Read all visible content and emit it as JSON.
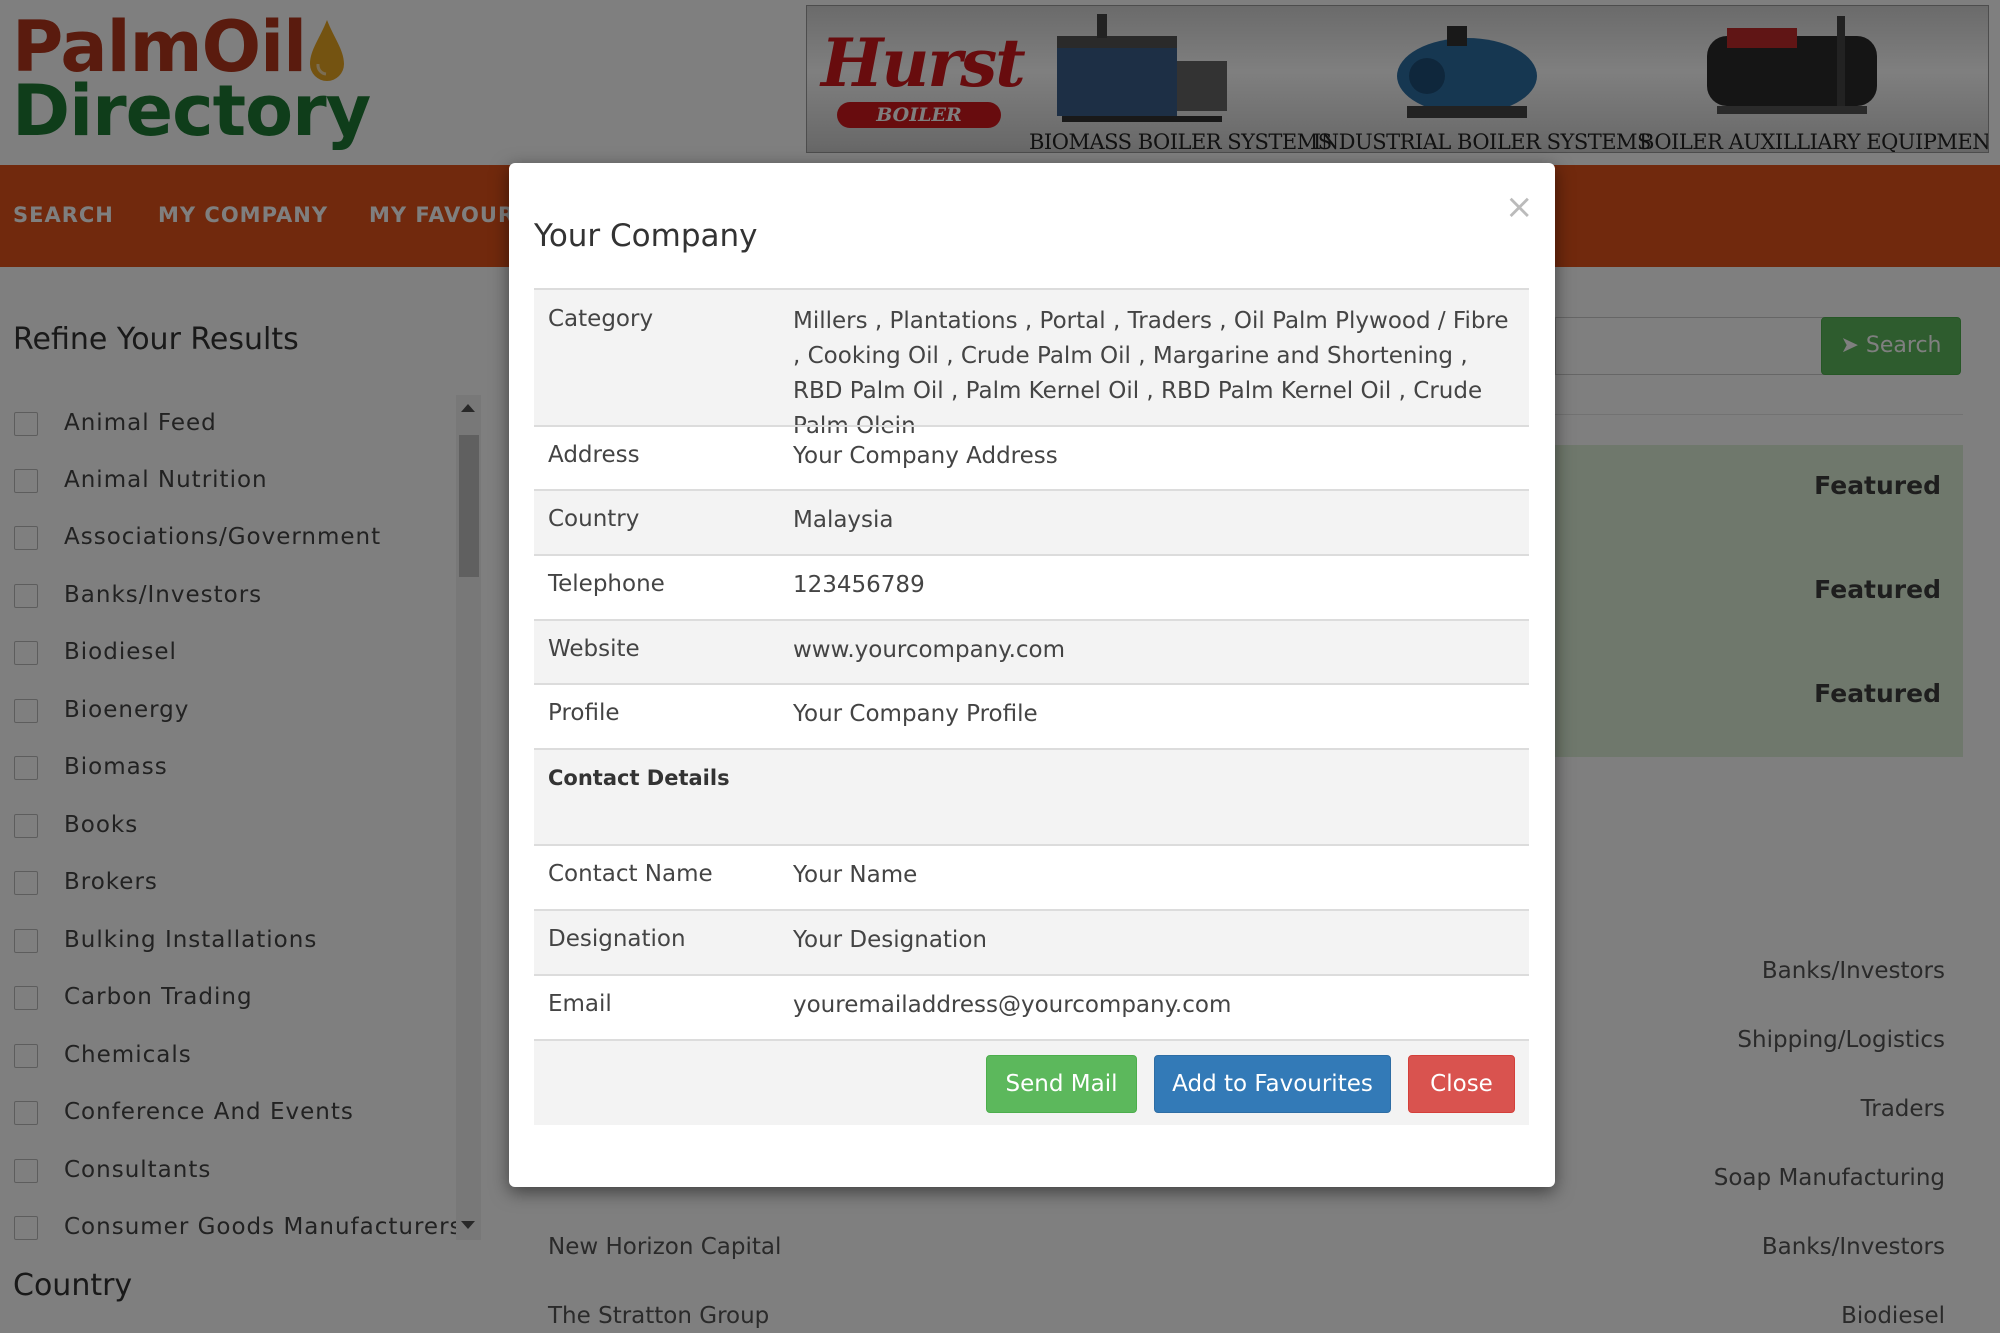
{
  "logo": {
    "line1": "PalmOil",
    "line2": "Directory"
  },
  "banner": {
    "brand": "Hurst",
    "brand_sub": "BOILER",
    "captions": [
      "BIOMASS BOILER SYSTEMS",
      "INDUSTRIAL BOILER SYSTEMS",
      "BOILER AUXILLIARY EQUIPMENT"
    ]
  },
  "nav": {
    "items": [
      "SEARCH",
      "MY COMPANY",
      "MY FAVOUR"
    ]
  },
  "sidebar": {
    "title": "Refine Your Results",
    "categories": [
      "Animal Feed",
      "Animal Nutrition",
      "Associations/Government",
      "Banks/Investors",
      "Biodiesel",
      "Bioenergy",
      "Biomass",
      "Books",
      "Brokers",
      "Bulking Installations",
      "Carbon Trading",
      "Chemicals",
      "Conference And Events",
      "Consultants",
      "Consumer Goods Manufacturers"
    ],
    "country_title": "Country"
  },
  "main": {
    "search_button": "Search",
    "featured_label": "Featured",
    "right_categories": [
      "Banks/Investors",
      "Shipping/Logistics",
      "Traders",
      "Soap Manufacturing",
      "Banks/Investors",
      "Biodiesel"
    ],
    "companies": [
      "New Horizon Capital",
      "The Stratton Group"
    ]
  },
  "modal": {
    "title": "Your Company",
    "close_glyph": "×",
    "rows": [
      {
        "key": "Category",
        "value": "Millers , Plantations , Portal , Traders , Oil Palm Plywood / Fibre , Cooking Oil , Crude Palm Oil , Margarine and Shortening , RBD Palm Oil , Palm Kernel Oil , RBD Palm Kernel Oil , Crude Palm Olein"
      },
      {
        "key": "Address",
        "value": "Your Company Address"
      },
      {
        "key": "Country",
        "value": "Malaysia"
      },
      {
        "key": "Telephone",
        "value": "123456789"
      },
      {
        "key": "Website",
        "value": "www.yourcompany.com"
      },
      {
        "key": "Profile",
        "value": "Your Company Profile"
      }
    ],
    "contact_heading": "Contact Details",
    "contact_rows": [
      {
        "key": "Contact Name",
        "value": "Your Name"
      },
      {
        "key": "Designation",
        "value": "Your Designation"
      },
      {
        "key": "Email",
        "value": "youremailaddress@yourcompany.com"
      }
    ],
    "buttons": {
      "send": "Send Mail",
      "favourite": "Add to Favourites",
      "close": "Close"
    }
  },
  "colors": {
    "nav": "#e2531b",
    "logo_red": "#b5371c",
    "logo_green": "#1e7a35",
    "success": "#5cb85c",
    "primary": "#337ab7",
    "danger": "#d9534f",
    "featured_bg": "#dff0d8"
  }
}
